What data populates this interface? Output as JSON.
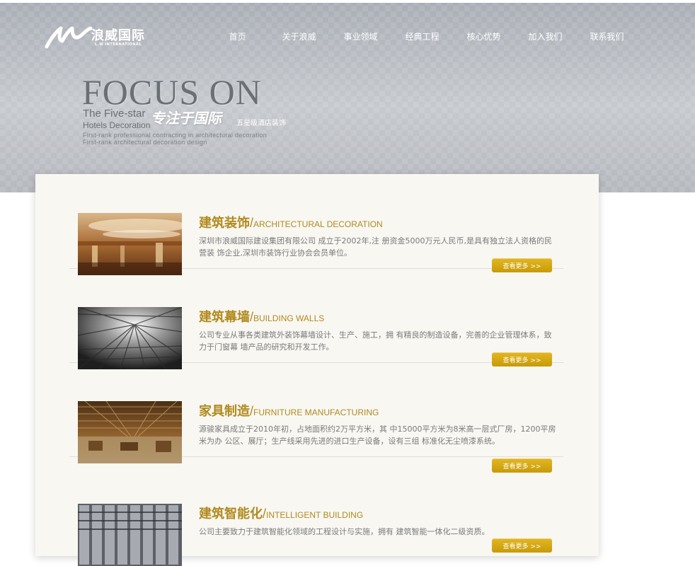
{
  "header": {
    "logo_text": "浪威国际",
    "logo_sub": "L.W INTERNATIONAL",
    "nav": [
      {
        "label": "首页"
      },
      {
        "label": "关于浪威"
      },
      {
        "label": "事业领域"
      },
      {
        "label": "经典工程"
      },
      {
        "label": "核心优势"
      },
      {
        "label": "加入我们"
      },
      {
        "label": "联系我们"
      }
    ]
  },
  "banner": {
    "focus": "FOCUS  ON",
    "five_star": "The Five-star",
    "hotels_decoration": "Hotels Decoration",
    "slogan_cn": "专注于国际",
    "slogan_cn_sub": "五星级酒店装饰",
    "eng_line_1": "First-rank professional contracting in architectural decoration",
    "eng_line_2": "First-rank architectural decoration design"
  },
  "sections": [
    {
      "title_cn": "建筑装饰",
      "slash": "/",
      "title_en": "ARCHITECTURAL DECORATION",
      "desc": "深圳市浪威国际建设集团有限公司 成立于2002年,注 册资金5000万元人民币,是具有独立法人资格的民营装 饰企业,深圳市装饰行业协会会员单位。",
      "more": "查看更多 >>",
      "image": "hotel-interior-image"
    },
    {
      "title_cn": "建筑幕墙",
      "slash": "/",
      "title_en": "BUILDING WALLS",
      "desc": "公司专业从事各类建筑外装饰幕墙设计、生产、施工，拥 有精良的制造设备，完善的企业管理体系，致力于门窗幕 墙产品的研究和开发工作。",
      "more": "查看更多 >>",
      "image": "glass-facade-image"
    },
    {
      "title_cn": "家具制造",
      "slash": "/",
      "title_en": "FURNITURE MANUFACTURING",
      "desc": "源骏家具成立于2010年初，占地面积约2万平方米，其 中15000平方米为8米高一层式厂房，1200平房米为办 公区、展厅；生产线采用先进的进口生产设备，设有三组 标准化无尘喷漆系统。",
      "more": "查看更多 >>",
      "image": "factory-hall-image"
    },
    {
      "title_cn": "建筑智能化",
      "slash": "/",
      "title_en": "INTELLIGENT BUILDING",
      "desc": "公司主要致力于建筑智能化领域的工程设计与实施，拥有 建筑智能一体化二级资质。",
      "more": "查看更多 >>",
      "image": "server-cables-image"
    }
  ]
}
